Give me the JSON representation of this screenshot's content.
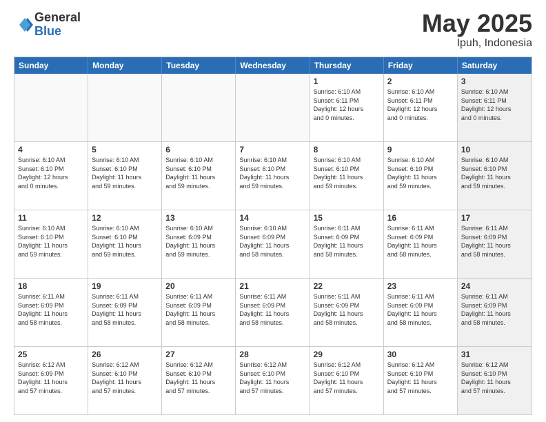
{
  "header": {
    "logo_general": "General",
    "logo_blue": "Blue",
    "title": "May 2025",
    "location": "Ipuh, Indonesia"
  },
  "weekdays": [
    "Sunday",
    "Monday",
    "Tuesday",
    "Wednesday",
    "Thursday",
    "Friday",
    "Saturday"
  ],
  "rows": [
    [
      {
        "day": "",
        "info": "",
        "empty": true
      },
      {
        "day": "",
        "info": "",
        "empty": true
      },
      {
        "day": "",
        "info": "",
        "empty": true
      },
      {
        "day": "",
        "info": "",
        "empty": true
      },
      {
        "day": "1",
        "info": "Sunrise: 6:10 AM\nSunset: 6:11 PM\nDaylight: 12 hours\nand 0 minutes.",
        "empty": false
      },
      {
        "day": "2",
        "info": "Sunrise: 6:10 AM\nSunset: 6:11 PM\nDaylight: 12 hours\nand 0 minutes.",
        "empty": false
      },
      {
        "day": "3",
        "info": "Sunrise: 6:10 AM\nSunset: 6:11 PM\nDaylight: 12 hours\nand 0 minutes.",
        "empty": false,
        "shaded": true
      }
    ],
    [
      {
        "day": "4",
        "info": "Sunrise: 6:10 AM\nSunset: 6:10 PM\nDaylight: 12 hours\nand 0 minutes.",
        "empty": false
      },
      {
        "day": "5",
        "info": "Sunrise: 6:10 AM\nSunset: 6:10 PM\nDaylight: 11 hours\nand 59 minutes.",
        "empty": false
      },
      {
        "day": "6",
        "info": "Sunrise: 6:10 AM\nSunset: 6:10 PM\nDaylight: 11 hours\nand 59 minutes.",
        "empty": false
      },
      {
        "day": "7",
        "info": "Sunrise: 6:10 AM\nSunset: 6:10 PM\nDaylight: 11 hours\nand 59 minutes.",
        "empty": false
      },
      {
        "day": "8",
        "info": "Sunrise: 6:10 AM\nSunset: 6:10 PM\nDaylight: 11 hours\nand 59 minutes.",
        "empty": false
      },
      {
        "day": "9",
        "info": "Sunrise: 6:10 AM\nSunset: 6:10 PM\nDaylight: 11 hours\nand 59 minutes.",
        "empty": false
      },
      {
        "day": "10",
        "info": "Sunrise: 6:10 AM\nSunset: 6:10 PM\nDaylight: 11 hours\nand 59 minutes.",
        "empty": false,
        "shaded": true
      }
    ],
    [
      {
        "day": "11",
        "info": "Sunrise: 6:10 AM\nSunset: 6:10 PM\nDaylight: 11 hours\nand 59 minutes.",
        "empty": false
      },
      {
        "day": "12",
        "info": "Sunrise: 6:10 AM\nSunset: 6:10 PM\nDaylight: 11 hours\nand 59 minutes.",
        "empty": false
      },
      {
        "day": "13",
        "info": "Sunrise: 6:10 AM\nSunset: 6:09 PM\nDaylight: 11 hours\nand 59 minutes.",
        "empty": false
      },
      {
        "day": "14",
        "info": "Sunrise: 6:10 AM\nSunset: 6:09 PM\nDaylight: 11 hours\nand 58 minutes.",
        "empty": false
      },
      {
        "day": "15",
        "info": "Sunrise: 6:11 AM\nSunset: 6:09 PM\nDaylight: 11 hours\nand 58 minutes.",
        "empty": false
      },
      {
        "day": "16",
        "info": "Sunrise: 6:11 AM\nSunset: 6:09 PM\nDaylight: 11 hours\nand 58 minutes.",
        "empty": false
      },
      {
        "day": "17",
        "info": "Sunrise: 6:11 AM\nSunset: 6:09 PM\nDaylight: 11 hours\nand 58 minutes.",
        "empty": false,
        "shaded": true
      }
    ],
    [
      {
        "day": "18",
        "info": "Sunrise: 6:11 AM\nSunset: 6:09 PM\nDaylight: 11 hours\nand 58 minutes.",
        "empty": false
      },
      {
        "day": "19",
        "info": "Sunrise: 6:11 AM\nSunset: 6:09 PM\nDaylight: 11 hours\nand 58 minutes.",
        "empty": false
      },
      {
        "day": "20",
        "info": "Sunrise: 6:11 AM\nSunset: 6:09 PM\nDaylight: 11 hours\nand 58 minutes.",
        "empty": false
      },
      {
        "day": "21",
        "info": "Sunrise: 6:11 AM\nSunset: 6:09 PM\nDaylight: 11 hours\nand 58 minutes.",
        "empty": false
      },
      {
        "day": "22",
        "info": "Sunrise: 6:11 AM\nSunset: 6:09 PM\nDaylight: 11 hours\nand 58 minutes.",
        "empty": false
      },
      {
        "day": "23",
        "info": "Sunrise: 6:11 AM\nSunset: 6:09 PM\nDaylight: 11 hours\nand 58 minutes.",
        "empty": false
      },
      {
        "day": "24",
        "info": "Sunrise: 6:11 AM\nSunset: 6:09 PM\nDaylight: 11 hours\nand 58 minutes.",
        "empty": false,
        "shaded": true
      }
    ],
    [
      {
        "day": "25",
        "info": "Sunrise: 6:12 AM\nSunset: 6:09 PM\nDaylight: 11 hours\nand 57 minutes.",
        "empty": false
      },
      {
        "day": "26",
        "info": "Sunrise: 6:12 AM\nSunset: 6:10 PM\nDaylight: 11 hours\nand 57 minutes.",
        "empty": false
      },
      {
        "day": "27",
        "info": "Sunrise: 6:12 AM\nSunset: 6:10 PM\nDaylight: 11 hours\nand 57 minutes.",
        "empty": false
      },
      {
        "day": "28",
        "info": "Sunrise: 6:12 AM\nSunset: 6:10 PM\nDaylight: 11 hours\nand 57 minutes.",
        "empty": false
      },
      {
        "day": "29",
        "info": "Sunrise: 6:12 AM\nSunset: 6:10 PM\nDaylight: 11 hours\nand 57 minutes.",
        "empty": false
      },
      {
        "day": "30",
        "info": "Sunrise: 6:12 AM\nSunset: 6:10 PM\nDaylight: 11 hours\nand 57 minutes.",
        "empty": false
      },
      {
        "day": "31",
        "info": "Sunrise: 6:12 AM\nSunset: 6:10 PM\nDaylight: 11 hours\nand 57 minutes.",
        "empty": false,
        "shaded": true
      }
    ]
  ]
}
